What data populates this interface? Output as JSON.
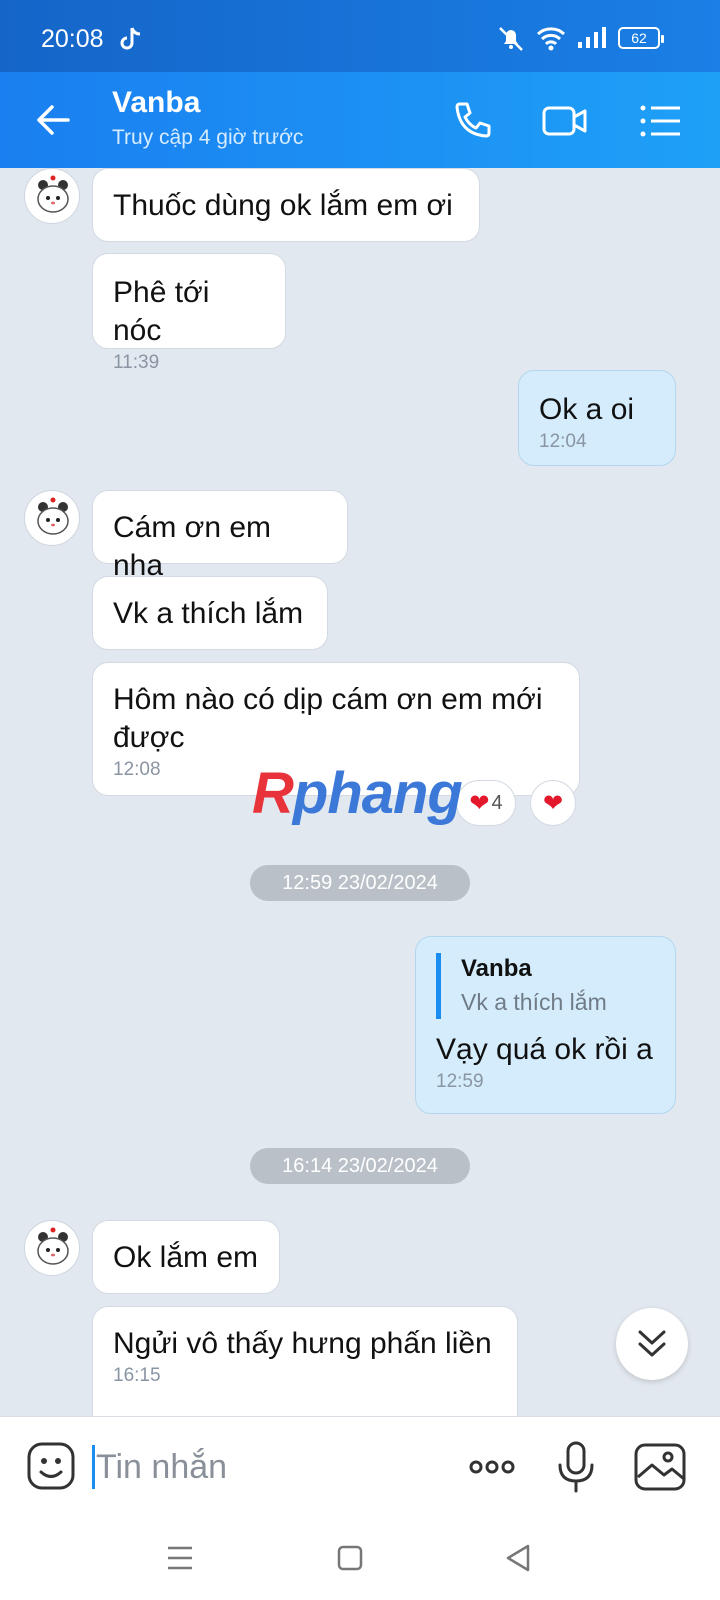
{
  "status_bar": {
    "time": "20:08",
    "battery": "62"
  },
  "header": {
    "name": "Vanba",
    "status": "Truy cập 4 giờ trước"
  },
  "messages": {
    "m1": {
      "text": "Thuốc dùng ok lắm em ơi"
    },
    "m2": {
      "text": "Phê tới nóc",
      "time": "11:39"
    },
    "m3": {
      "text": "Ok a oi",
      "time": "12:04"
    },
    "m4": {
      "text": "Cám ơn em nha"
    },
    "m5": {
      "text": "Vk a thích lắm"
    },
    "m6": {
      "text": "Hôm nào có dịp cám ơn em mới được",
      "time": "12:08",
      "reaction_count": "4"
    },
    "date1": "12:59 23/02/2024",
    "m7": {
      "quote_name": "Vanba",
      "quote_text": "Vk a thích lắm",
      "text": "Vạy quá ok rồi a",
      "time": "12:59"
    },
    "date2": "16:14 23/02/2024",
    "m8": {
      "text": "Ok lắm em"
    },
    "m9": {
      "text": "Ngửi vô thấy hưng phấn liền",
      "time": "16:15"
    }
  },
  "watermark": {
    "first": "R",
    "rest": "phang"
  },
  "input": {
    "placeholder": "Tin nhắn"
  },
  "colors": {
    "header": "#1a8ef0",
    "mine_bubble": "#d4ecfb",
    "heart": "#e3182d",
    "chat_bg": "#e2e8ef"
  },
  "icons": [
    "back-icon",
    "phone-icon",
    "video-call-icon",
    "menu-list-icon",
    "emoji-icon",
    "more-icon",
    "mic-icon",
    "image-icon",
    "heart-icon",
    "chevron-double-down-icon"
  ]
}
